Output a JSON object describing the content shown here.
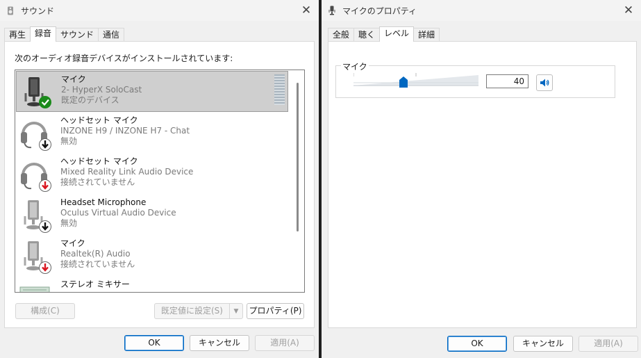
{
  "sound_window": {
    "title": "サウンド",
    "tabs": [
      {
        "label": "再生",
        "active": false
      },
      {
        "label": "録音",
        "active": true
      },
      {
        "label": "サウンド",
        "active": false
      },
      {
        "label": "通信",
        "active": false
      }
    ],
    "intro": "次のオーディオ録音デバイスがインストールされています:",
    "devices": [
      {
        "name": "マイク",
        "desc": "2- HyperX SoloCast",
        "status": "既定のデバイス",
        "icon": "microphone-icon",
        "badge": "default-check-icon",
        "selected": true
      },
      {
        "name": "ヘッドセット マイク",
        "desc": "INZONE H9 / INZONE H7 - Chat",
        "status": "無効",
        "icon": "headset-icon",
        "badge": "disabled-arrow-icon",
        "selected": false
      },
      {
        "name": "ヘッドセット マイク",
        "desc": "Mixed Reality Link Audio Device",
        "status": "接続されていません",
        "icon": "headset-icon",
        "badge": "disconnected-arrow-icon",
        "selected": false
      },
      {
        "name": "Headset Microphone",
        "desc": "Oculus Virtual Audio Device",
        "status": "無効",
        "icon": "microphone-icon",
        "badge": "disabled-arrow-icon",
        "selected": false
      },
      {
        "name": "マイク",
        "desc": "Realtek(R) Audio",
        "status": "接続されていません",
        "icon": "microphone-icon",
        "badge": "disconnected-arrow-icon",
        "selected": false
      },
      {
        "name": "ステレオ ミキサー",
        "desc": "",
        "status": "",
        "icon": "stereo-mixer-icon",
        "badge": "",
        "selected": false
      }
    ],
    "buttons": {
      "configure": "構成(C)",
      "set_default": "既定値に設定(S)",
      "properties": "プロパティ(P)",
      "ok": "OK",
      "cancel": "キャンセル",
      "apply": "適用(A)"
    }
  },
  "props_window": {
    "title": "マイクのプロパティ",
    "tabs": [
      {
        "label": "全般",
        "active": false
      },
      {
        "label": "聴く",
        "active": false
      },
      {
        "label": "レベル",
        "active": true
      },
      {
        "label": "詳細",
        "active": false
      }
    ],
    "group_title": "マイク",
    "level": 40,
    "level_fraction": 0.4,
    "buttons": {
      "ok": "OK",
      "cancel": "キャンセル",
      "apply": "適用(A)"
    }
  },
  "colors": {
    "accent": "#0067c0",
    "check_green": "#1a8a1a",
    "arrow_red": "#d9151f",
    "arrow_black": "#111111"
  }
}
